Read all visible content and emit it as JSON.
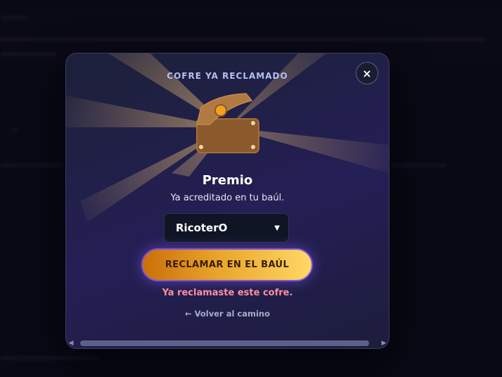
{
  "modal": {
    "title": "COFRE YA RECLAMADO",
    "close_icon": "×",
    "heading": "Premio",
    "subtitle": "Ya acreditado en tu baúl.",
    "select": {
      "value": "RicoterO",
      "icon": "chevron-down-icon"
    },
    "claim_button": "RECLAMAR EN EL BAÚL",
    "status": "Ya reclamaste este cofre.",
    "back_link": "← Volver al camino"
  },
  "colors": {
    "accent_gold": "#ffd866",
    "accent_orange": "#c96f0a",
    "status_error": "#ff8f9c",
    "title": "#b6bff5"
  }
}
